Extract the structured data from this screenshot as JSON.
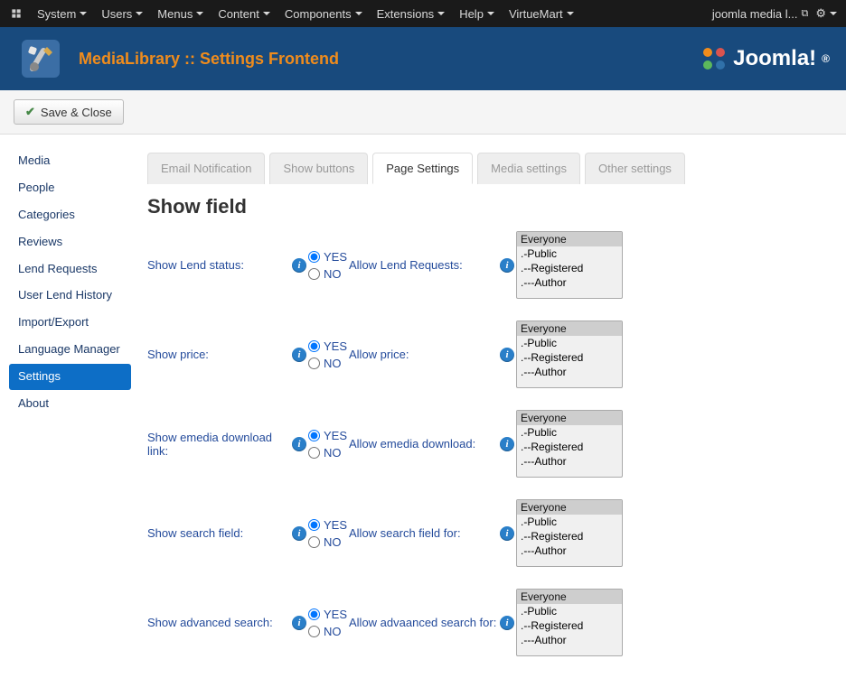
{
  "admin_menu": {
    "items": [
      "System",
      "Users",
      "Menus",
      "Content",
      "Components",
      "Extensions",
      "Help",
      "VirtueMart"
    ],
    "site_link": "joomla media l..."
  },
  "header": {
    "title": "MediaLibrary :: Settings Frontend",
    "brand": "Joomla!"
  },
  "toolbar": {
    "save_close": "Save & Close"
  },
  "sidebar": {
    "items": [
      "Media",
      "People",
      "Categories",
      "Reviews",
      "Lend Requests",
      "User Lend History",
      "Import/Export",
      "Language Manager",
      "Settings",
      "About"
    ],
    "active": "Settings"
  },
  "tabs": {
    "items": [
      "Email Notification",
      "Show buttons",
      "Page Settings",
      "Media settings",
      "Other settings"
    ],
    "active": "Page Settings"
  },
  "section_title": "Show field",
  "radio": {
    "yes": "YES",
    "no": "NO"
  },
  "rows": [
    {
      "label1": "Show Lend status:",
      "label2": "Allow Lend Requests:"
    },
    {
      "label1": "Show price:",
      "label2": "Allow price:"
    },
    {
      "label1": "Show emedia download link:",
      "label2": "Allow emedia download:"
    },
    {
      "label1": "Show search field:",
      "label2": "Allow search field for:"
    },
    {
      "label1": "Show advanced search:",
      "label2": "Allow advaanced search for:"
    }
  ],
  "select_options": [
    "Everyone",
    ".-Public",
    ".--Registered",
    ".---Author"
  ]
}
